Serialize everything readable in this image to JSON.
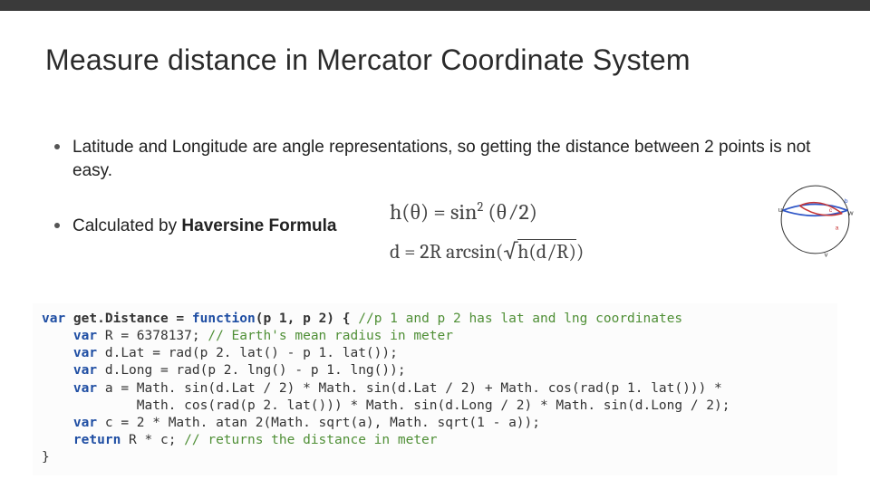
{
  "title": "Measure distance in Mercator Coordinate System",
  "bullet1": "Latitude and Longitude are angle representations, so getting the distance between 2 points is not easy.",
  "bullet2_pre": "Calculated by ",
  "bullet2_bold": "Haversine Formula",
  "formula1_left": "h(θ) = sin",
  "formula1_exp": "2",
  "formula1_right": "(θ⁄2)",
  "formula2_pre": "d = 2R arcsin(",
  "formula2_sqrt": "h(d/R)",
  "formula2_post": ")",
  "diagram": {
    "u": "u",
    "v": "v",
    "w": "w",
    "a": "a",
    "b": "b",
    "c": "c"
  },
  "code": {
    "l1_a": "var",
    "l1_b": " get.Distance = ",
    "l1_c": "function",
    "l1_d": "(p 1, p 2) { ",
    "l1_e": "//p 1 and p 2 has lat and lng coordinates",
    "l2_a": "var",
    "l2_b": " R = 6378137; ",
    "l2_c": "// Earth's mean radius in meter",
    "l3_a": "var",
    "l3_b": " d.Lat = rad(p 2. lat() - p 1. lat());",
    "l4_a": "var",
    "l4_b": " d.Long = rad(p 2. lng() - p 1. lng());",
    "l5_a": "var",
    "l5_b": " a = Math. sin(d.Lat / 2) * Math. sin(d.Lat / 2) + Math. cos(rad(p 1. lat())) *",
    "l5_c": "            Math. cos(rad(p 2. lat())) * Math. sin(d.Long / 2) * Math. sin(d.Long / 2);",
    "l6_a": "var",
    "l6_b": " c = 2 * Math. atan 2(Math. sqrt(a), Math. sqrt(1 - a));",
    "l7_a": "return",
    "l7_b": " R * c; ",
    "l7_c": "// returns the distance in meter",
    "l8": "}"
  }
}
